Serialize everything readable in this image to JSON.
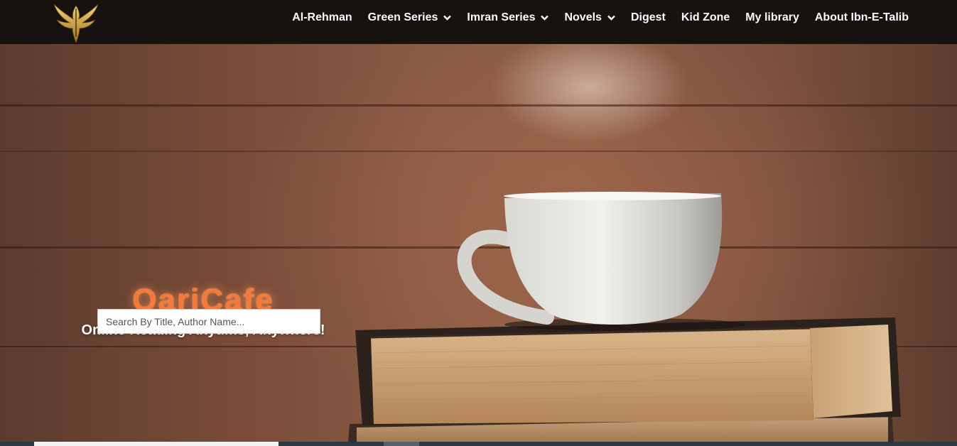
{
  "header": {
    "nav": [
      {
        "label": "Al-Rehman",
        "has_dropdown": false
      },
      {
        "label": "Green Series",
        "has_dropdown": true
      },
      {
        "label": "Imran Series",
        "has_dropdown": true
      },
      {
        "label": "Novels",
        "has_dropdown": true
      },
      {
        "label": "Digest",
        "has_dropdown": false
      },
      {
        "label": "Kid Zone",
        "has_dropdown": false
      },
      {
        "label": "My library",
        "has_dropdown": false
      },
      {
        "label": "About Ibn-E-Talib",
        "has_dropdown": false
      }
    ],
    "logo_icon": "phoenix-logo-icon"
  },
  "hero": {
    "brand": "QariCafe",
    "tagline": "Online Reading Anytime, Anywhere!",
    "search_placeholder": "Search By Title, Author Name..."
  },
  "colors": {
    "header_bg": "#171110",
    "brand_orange": "#f47a3c",
    "nav_text": "#ffffff",
    "wood": "#8a5a44"
  }
}
